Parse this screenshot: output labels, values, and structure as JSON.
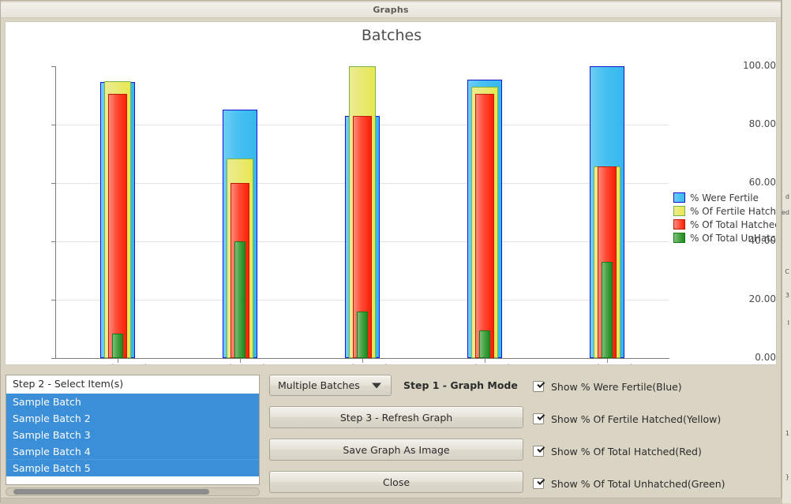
{
  "window": {
    "title": "Graphs"
  },
  "chart": {
    "title": "Batches",
    "ylabels": [
      "100.00",
      "80.00",
      "60.00",
      "40.00",
      "20.00",
      "0.00"
    ],
    "legend": [
      {
        "label": "% Were Fertile",
        "color": "#35b8ee",
        "key": "blue"
      },
      {
        "label": "% Of Fertile Hatched",
        "color": "#e8e850",
        "key": "yellow"
      },
      {
        "label": "% Of Total Hatched",
        "color": "#fb1f05",
        "key": "red"
      },
      {
        "label": "% Of Total UnHatched",
        "color": "#1c8a1c",
        "key": "green"
      }
    ]
  },
  "chart_data": {
    "type": "bar",
    "title": "Batches",
    "xlabel": "",
    "ylabel": "",
    "ylim": [
      0,
      100
    ],
    "yticks": [
      0,
      20,
      40,
      60,
      80,
      100
    ],
    "grid": true,
    "legend_position": "right",
    "grouping": "overlapping-nested-bars",
    "categories": [
      "Sample Batch",
      "Sample Batch 2",
      "Sample Batch 3",
      "Sample Batch 4",
      "Sample Batch 5"
    ],
    "series": [
      {
        "name": "% Were Fertile",
        "color": "#35b8ee",
        "values": [
          94.5,
          85.2,
          83.0,
          95.5,
          100.0
        ]
      },
      {
        "name": "% Of Fertile Hatched",
        "color": "#e8e850",
        "values": [
          95.0,
          68.5,
          100.0,
          93.0,
          65.8
        ]
      },
      {
        "name": "% Of Total Hatched",
        "color": "#fb1f05",
        "values": [
          90.5,
          60.0,
          83.0,
          90.5,
          65.6
        ]
      },
      {
        "name": "% Of Total UnHatched",
        "color": "#1c8a1c",
        "values": [
          8.5,
          40.0,
          16.0,
          9.5,
          33.0
        ]
      }
    ]
  },
  "controls": {
    "listbox": {
      "header": "Step 2 - Select Item(s)",
      "items": [
        "Sample Batch",
        "Sample Batch 2",
        "Sample Batch 3",
        "Sample Batch 4",
        "Sample Batch 5"
      ]
    },
    "mode_combo": {
      "value": "Multiple Batches"
    },
    "step1_label": "Step 1 - Graph Mode",
    "buttons": {
      "refresh": "Step 3 - Refresh Graph",
      "save": "Save Graph As Image",
      "close": "Close"
    },
    "checkboxes": [
      {
        "label": "Show % Were Fertile(Blue)",
        "checked": true
      },
      {
        "label": "Show % Of Fertile Hatched(Yellow)",
        "checked": true
      },
      {
        "label": "Show % Of Total Hatched(Red)",
        "checked": true
      },
      {
        "label": "Show % Of Total Unhatched(Green)",
        "checked": true
      }
    ]
  },
  "background": {
    "fragments": [
      "d",
      "ed",
      "C",
      "3",
      "I",
      "1",
      "}"
    ]
  }
}
